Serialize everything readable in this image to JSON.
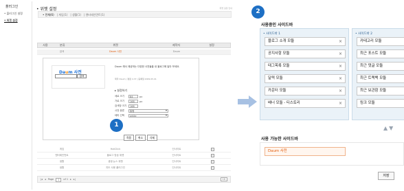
{
  "left": {
    "nav": {
      "title": "플러그인",
      "items": [
        "• 플러그인 설정",
        "• 위젯 설정"
      ]
    },
    "page_title": "• 위젯 설정",
    "page_hint": "위젯 설정 안내",
    "sub_tabs": [
      "• 전체(6)",
      "| 게임(1)",
      "| 생활(1)",
      "| 엔터테인먼트(1)"
    ],
    "grid_headers": [
      "사용",
      "분류",
      "위젯",
      "제작자",
      "설정"
    ],
    "first_row": {
      "use": "",
      "category": "검색",
      "widget": "Daum 사전",
      "maker": "Daum"
    },
    "preview": {
      "logo_prefix": "Da",
      "logo_o": "u",
      "logo_suffix": "m",
      "logo_dic": "사전",
      "button": "검색"
    },
    "description": "Daum 에서 제공하는 다양한 사전들을 내 블로그에 달아 보세요.",
    "meta": "제작 Daum | 평점 4.37 | 등록일 2009.05.01",
    "settings": {
      "title": "▸ 설정하기",
      "rows": [
        {
          "label": "세로 크기",
          "value": "84",
          "unit": "px"
        },
        {
          "label": "가로 크기",
          "value": "168",
          "unit": "px"
        },
        {
          "label": "검색창 크기",
          "value": "168",
          "unit": ""
        }
      ],
      "selects": [
        {
          "label": "사전 종류",
          "value": "통합"
        },
        {
          "label": "테마 선택",
          "value": "white"
        }
      ]
    },
    "buttons": {
      "apply": "적용",
      "cancel": "취소",
      "delete": "삭제"
    },
    "rows": [
      {
        "category": "게임",
        "widget": "HotClick",
        "maker": "인사이트"
      },
      {
        "category": "엔터테인먼트",
        "widget": "블로그 방송 위젯",
        "maker": "인사이트"
      },
      {
        "category": "생활",
        "widget": "생생 뉴스 위젯",
        "maker": "인사이트"
      },
      {
        "category": "생활",
        "widget": "지도 사용 플러그인",
        "maker": "인사이트"
      }
    ],
    "pager": {
      "text": "Page",
      "current": "1",
      "of": "of 1",
      "per_page": "10"
    }
  },
  "step_numbers": [
    "1",
    "2"
  ],
  "right": {
    "using_title": "사용중인 사이드바",
    "col1": {
      "header": "• 사이드바 1",
      "items": [
        "블로그 소개 모듈",
        "공지사항 모듈",
        "태그목록 모듈",
        "달력 모듈",
        "카운터 모듈",
        "배너 모듈 - 티스토리"
      ]
    },
    "col2": {
      "header": "• 사이드바 2",
      "items": [
        "카테고리 모듈",
        "최근 포스트 모듈",
        "최근 댓글 모듈",
        "최근 트랙백 모듈",
        "최근 보관함 모듈",
        "링크 모듈"
      ]
    },
    "close_mark": "×",
    "available_title": "사용 가능한 사이드바",
    "available_item": "Daum 사전",
    "save": "저장"
  },
  "colors": {
    "accent": "#1d6fc4",
    "highlight": "#e25b0a",
    "panel": "#eaf2f8"
  }
}
